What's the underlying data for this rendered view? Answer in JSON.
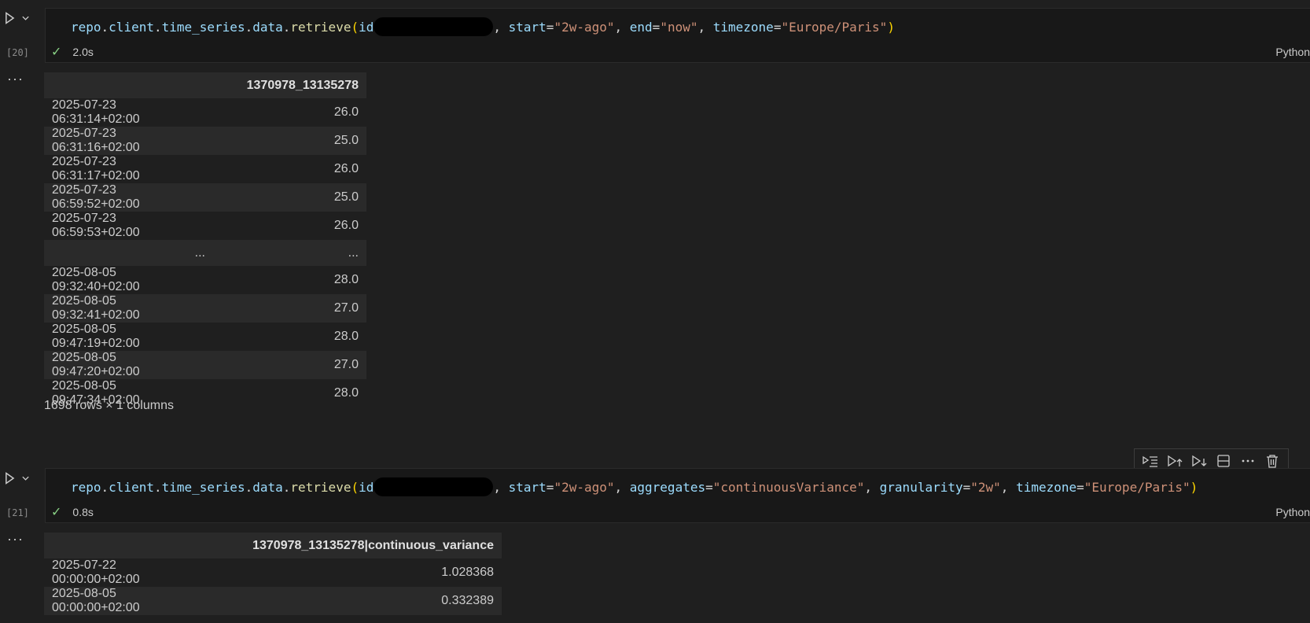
{
  "cells": [
    {
      "exec_count": "[20]",
      "code": {
        "obj": "repo",
        "chain1": "client",
        "chain2": "time_series",
        "chain3": "data",
        "fn": "retrieve",
        "arg_prefix": "id",
        "arg_rest_1_key": "start",
        "arg_rest_1_val": "\"2w-ago\"",
        "arg_rest_2_key": "end",
        "arg_rest_2_val": "\"now\"",
        "arg_rest_3_key": "timezone",
        "arg_rest_3_val": "\"Europe/Paris\""
      },
      "duration": "2.0s",
      "language": "Python",
      "table": {
        "header_index": "",
        "header_col": "1370978_13135278",
        "rows": [
          {
            "idx": "2025-07-23 06:31:14+02:00",
            "val": "26.0"
          },
          {
            "idx": "2025-07-23 06:31:16+02:00",
            "val": "25.0"
          },
          {
            "idx": "2025-07-23 06:31:17+02:00",
            "val": "26.0"
          },
          {
            "idx": "2025-07-23 06:59:52+02:00",
            "val": "25.0"
          },
          {
            "idx": "2025-07-23 06:59:53+02:00",
            "val": "26.0"
          },
          {
            "idx": "...",
            "val": "..."
          },
          {
            "idx": "2025-08-05 09:32:40+02:00",
            "val": "28.0"
          },
          {
            "idx": "2025-08-05 09:32:41+02:00",
            "val": "27.0"
          },
          {
            "idx": "2025-08-05 09:47:19+02:00",
            "val": "28.0"
          },
          {
            "idx": "2025-08-05 09:47:20+02:00",
            "val": "27.0"
          },
          {
            "idx": "2025-08-05 09:47:34+02:00",
            "val": "28.0"
          }
        ],
        "summary": "1698 rows × 1 columns"
      }
    },
    {
      "exec_count": "[21]",
      "code": {
        "obj": "repo",
        "chain1": "client",
        "chain2": "time_series",
        "chain3": "data",
        "fn": "retrieve",
        "arg_prefix": "id",
        "arg_rest_1_key": "start",
        "arg_rest_1_val": "\"2w-ago\"",
        "arg_rest_2_key": "aggregates",
        "arg_rest_2_val": "\"continuousVariance\"",
        "arg_rest_3_key": "granularity",
        "arg_rest_3_val": "\"2w\"",
        "arg_rest_4_key": "timezone",
        "arg_rest_4_val": "\"Europe/Paris\""
      },
      "duration": "0.8s",
      "language": "Python",
      "table": {
        "header_col": "1370978_13135278|continuous_variance",
        "rows": [
          {
            "idx": "2025-07-22 00:00:00+02:00",
            "val": "1.028368"
          },
          {
            "idx": "2025-08-05 00:00:00+02:00",
            "val": "0.332389"
          }
        ]
      }
    }
  ],
  "toolbar": {
    "icons": [
      "run-by-line-icon",
      "execute-above-icon",
      "execute-below-icon",
      "split-cell-icon",
      "more-actions-icon",
      "delete-cell-icon"
    ]
  },
  "ellipsis": "···"
}
